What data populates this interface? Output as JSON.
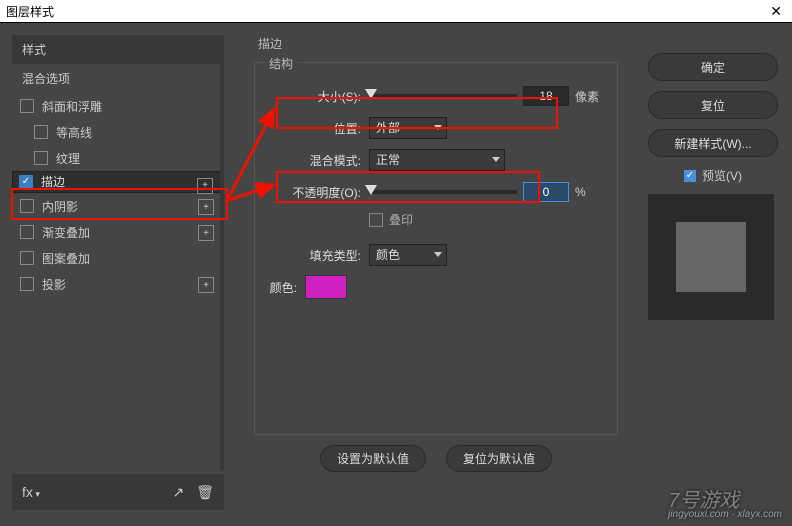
{
  "title": "图层样式",
  "left": {
    "header_styles": "样式",
    "header_blend": "混合选项",
    "items": [
      {
        "label": "斜面和浮雕",
        "checked": false,
        "plus": false,
        "sub": false
      },
      {
        "label": "等高线",
        "checked": false,
        "plus": false,
        "sub": true
      },
      {
        "label": "纹理",
        "checked": false,
        "plus": false,
        "sub": true
      },
      {
        "label": "描边",
        "checked": true,
        "plus": true,
        "sub": false,
        "selected": true
      },
      {
        "label": "内阴影",
        "checked": false,
        "plus": true,
        "sub": false
      },
      {
        "label": "渐变叠加",
        "checked": false,
        "plus": true,
        "sub": false
      },
      {
        "label": "图案叠加",
        "checked": false,
        "plus": false,
        "sub": false
      },
      {
        "label": "投影",
        "checked": false,
        "plus": true,
        "sub": false
      }
    ],
    "footer_fx": "fx",
    "footer_trash": "🗑"
  },
  "mid": {
    "panel_title": "描边",
    "group_struct": "结构",
    "size_label": "大小(S):",
    "size_value": "18",
    "size_unit": "像素",
    "pos_label": "位置:",
    "pos_value": "外部",
    "blend_label": "混合模式:",
    "blend_value": "正常",
    "opac_label": "不透明度(O):",
    "opac_value": "0",
    "opac_unit": "%",
    "overprint": "叠印",
    "fill_label": "填充类型:",
    "fill_value": "颜色",
    "color_label": "颜色:",
    "color_hex": "#d020c0",
    "btn_default": "设置为默认值",
    "btn_reset": "复位为默认值"
  },
  "right": {
    "ok": "确定",
    "cancel": "复位",
    "newstyle": "新建样式(W)...",
    "preview": "预览(V)"
  },
  "wm_main": "7号游戏",
  "wm_sub": "jingyouxi.com · xlayx.com"
}
